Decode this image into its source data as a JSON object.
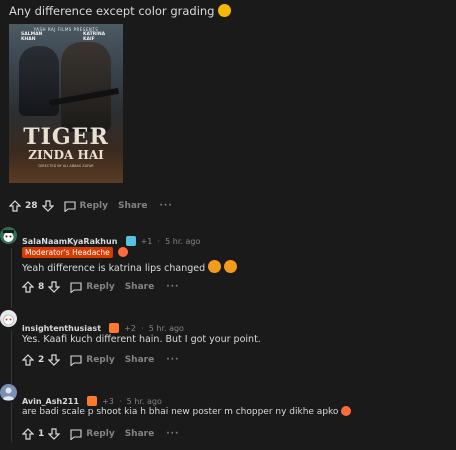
{
  "post": {
    "text": "Any difference except color grading",
    "emoji": "thinking-face-emoji",
    "image": {
      "banner": "YASH RAJ FILMS PRESENTS",
      "actor_left_line1": "SALMAN",
      "actor_left_line2": "KHAN",
      "actor_right_line1": "KATRINA",
      "actor_right_line2": "KAIF",
      "title_line1": "TIGER",
      "title_line2": "ZINDA HAI",
      "tagline": "DIRECTED BY ALI ABBAS ZAFAR"
    },
    "votes": "28",
    "reply_label": "Reply",
    "share_label": "Share",
    "more_label": "···"
  },
  "comments": [
    {
      "username": "SalaNaamKyaRakhun",
      "badge_icon": "mask-emoji",
      "karma": "+1",
      "dot": "·",
      "time": "5 hr. ago",
      "flair": "Moderator's Headache",
      "text": "Yeah difference is katrina lips changed",
      "votes": "8",
      "reply_label": "Reply",
      "share_label": "Share",
      "more_label": "···"
    },
    {
      "username": "insightenthusiast",
      "badge_icon": "fire-emoji",
      "karma": "+2",
      "dot": "·",
      "time": "5 hr. ago",
      "text": "Yes. Kaafi kuch different hain. But I got your point.",
      "votes": "2",
      "reply_label": "Reply",
      "share_label": "Share",
      "more_label": "···"
    },
    {
      "username": "Avin_Ash211",
      "badge_icon": "fire-emoji",
      "karma": "+3",
      "dot": "·",
      "time": "5 hr. ago",
      "text": "are badi scale p shoot kia h bhai new poster m chopper ny dikhe apko",
      "votes": "1",
      "reply_label": "Reply",
      "share_label": "Share",
      "more_label": "···"
    }
  ],
  "colors": {
    "background": "#1a1a1b",
    "text": "#d7dadc",
    "muted": "#818384",
    "flair": "#d93a00"
  }
}
